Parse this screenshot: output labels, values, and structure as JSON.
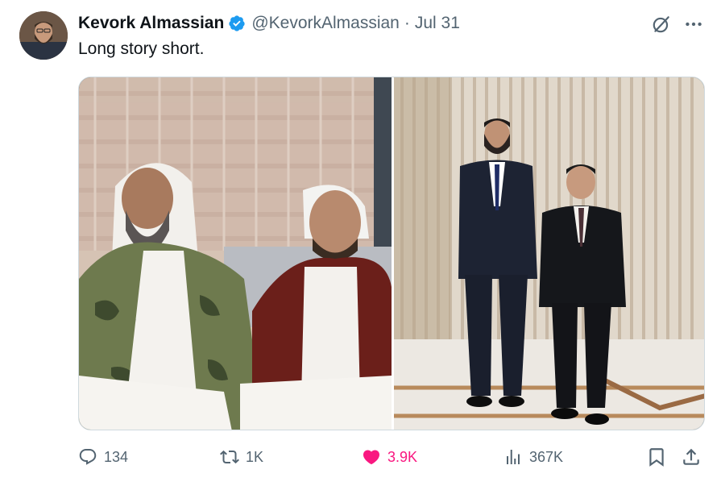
{
  "tweet": {
    "author_name": "Kevork Almassian",
    "handle": "@KevorkAlmassian",
    "separator": "·",
    "date": "Jul 31",
    "text": "Long story short.",
    "verified": true
  },
  "icons": {
    "grok": "grok-icon",
    "more": "more-icon",
    "reply": "reply-icon",
    "retweet": "retweet-icon",
    "like": "heart-icon",
    "views": "views-icon",
    "bookmark": "bookmark-icon",
    "share": "share-icon"
  },
  "metrics": {
    "replies": "134",
    "retweets": "1K",
    "likes": "3.9K",
    "views": "367K"
  },
  "colors": {
    "verified": "#1d9bf0",
    "like_active": "#f91880",
    "secondary_text": "#536471"
  }
}
